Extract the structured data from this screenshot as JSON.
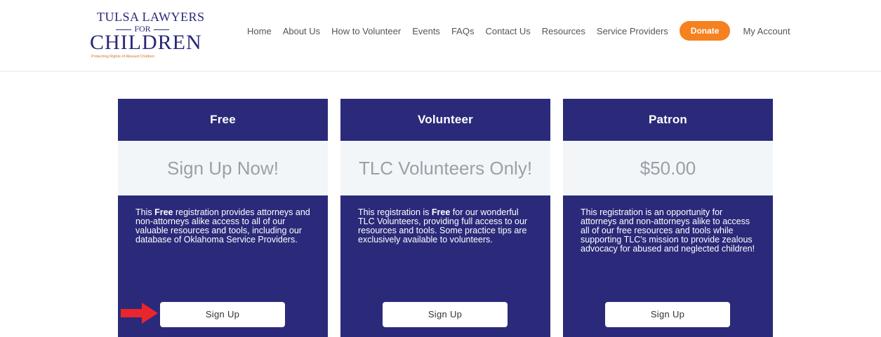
{
  "logo": {
    "line1": "TULSA LAWYERS",
    "line2": "FOR",
    "line3": "CHILDREN",
    "tagline": "Protecting Rights of Abused Children"
  },
  "nav": {
    "items": [
      "Home",
      "About Us",
      "How to Volunteer",
      "Events",
      "FAQs",
      "Contact Us",
      "Resources",
      "Service Providers"
    ],
    "donate": "Donate",
    "account": "My Account"
  },
  "cards": [
    {
      "title": "Free",
      "price": "Sign Up Now!",
      "desc_pre": "This ",
      "desc_bold": "Free",
      "desc_post": " registration provides attorneys and non-attorneys alike access to all of our valuable resources and tools, including our database of Oklahoma Service Providers.",
      "button": "Sign Up"
    },
    {
      "title": "Volunteer",
      "price": "TLC Volunteers Only!",
      "desc_pre": "This registration is ",
      "desc_bold": "Free",
      "desc_post": " for our wonderful TLC Volunteers, providing full access to our resources and tools. Some practice tips are exclusively available to volunteers.",
      "button": "Sign Up"
    },
    {
      "title": "Patron",
      "price": "$50.00",
      "desc_pre": "This registration is an opportunity for attorneys and non-attorneys alike to access all of our free resources and tools while supporting TLC's mission to provide zealous advocacy for abused and neglected children!",
      "desc_bold": "",
      "desc_post": "",
      "button": "Sign Up"
    }
  ],
  "colors": {
    "brand": "#2b2a7a",
    "accent": "#f5811f",
    "arrow": "#e8262b"
  },
  "annotation": {
    "icon": "arrow-right-icon"
  }
}
